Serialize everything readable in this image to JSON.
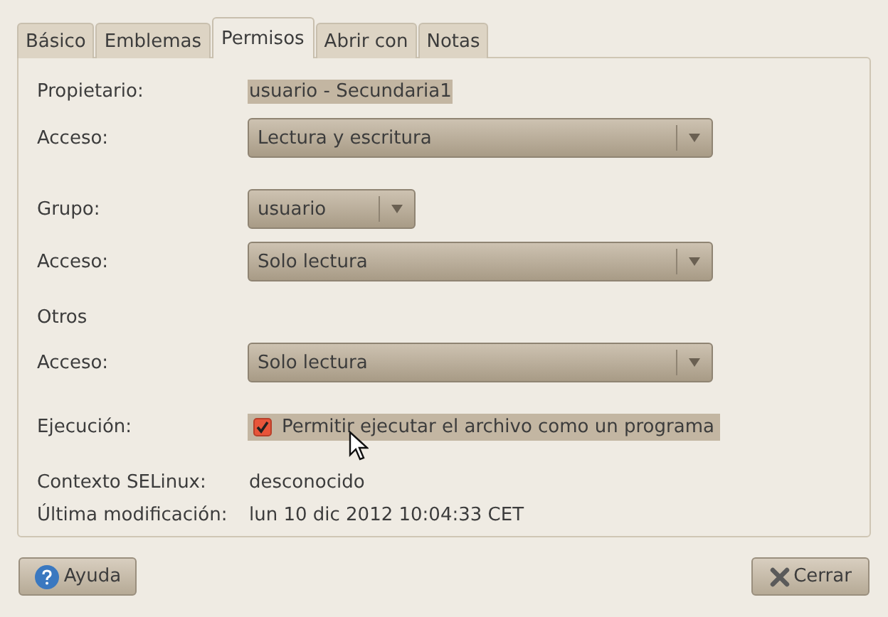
{
  "tabs": [
    {
      "label": "Básico",
      "selected": false
    },
    {
      "label": "Emblemas",
      "selected": false
    },
    {
      "label": "Permisos",
      "selected": true
    },
    {
      "label": "Abrir con",
      "selected": false
    },
    {
      "label": "Notas",
      "selected": false
    }
  ],
  "rows": [
    {
      "kind": "text",
      "label": "Propietario:",
      "value": "usuario - Secundaria1",
      "highlighted": true
    },
    {
      "kind": "combo",
      "label": "Acceso:",
      "value": "Lectura y escritura"
    },
    {
      "kind": "small_combo",
      "label": "Grupo:",
      "value": "usuario"
    },
    {
      "kind": "combo",
      "label": "Acceso:",
      "value": "Solo lectura"
    },
    {
      "kind": "heading",
      "label": "Otros"
    },
    {
      "kind": "combo",
      "label": "Acceso:",
      "value": "Solo lectura"
    },
    {
      "kind": "checkbox",
      "label": "Ejecución:",
      "value": "Permitir ejecutar el archivo como un programa",
      "checked": true,
      "highlighted": true
    },
    {
      "kind": "text",
      "label": "Contexto SELinux:",
      "value": "desconocido",
      "highlighted": false
    },
    {
      "kind": "text",
      "label": "Última modificación:",
      "value": "lun 10 dic 2012 10:04:33 CET",
      "highlighted": false
    }
  ],
  "buttons": [
    {
      "kind": "help",
      "label": "Ayuda"
    },
    {
      "kind": "close",
      "label": "Cerrar"
    }
  ]
}
